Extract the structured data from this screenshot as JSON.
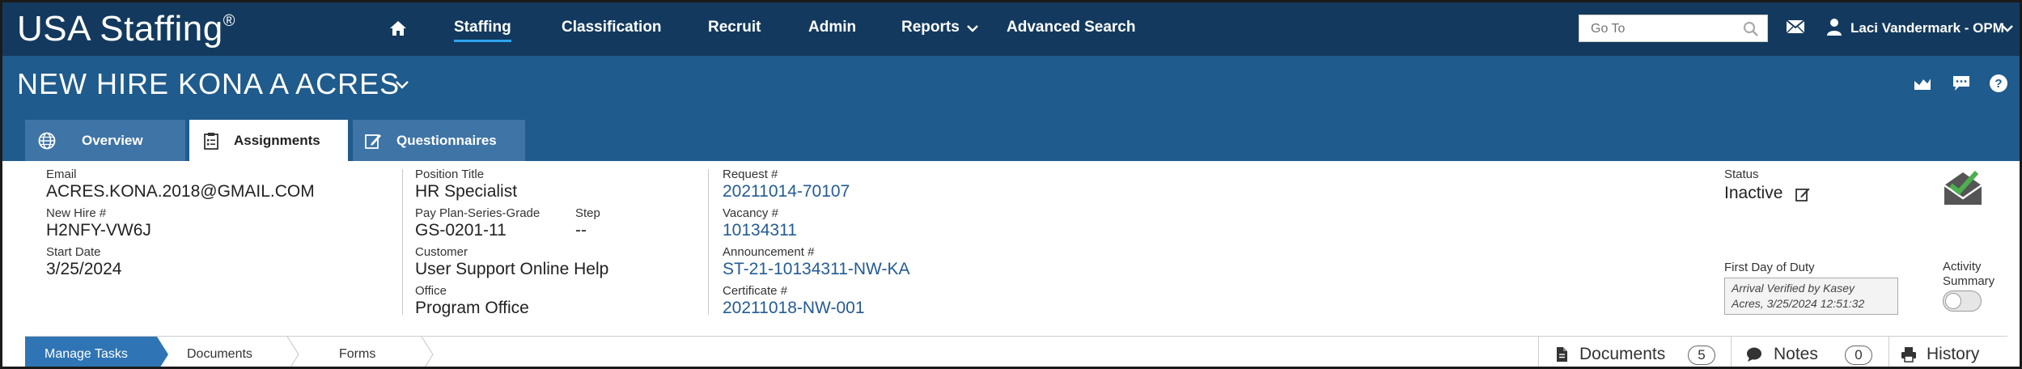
{
  "app": {
    "brand": "USA Staffing",
    "brand_mark": "®"
  },
  "nav": {
    "items": [
      {
        "label": "Staffing"
      },
      {
        "label": "Classification"
      },
      {
        "label": "Recruit"
      },
      {
        "label": "Admin"
      },
      {
        "label": "Reports"
      },
      {
        "label": "Advanced Search"
      }
    ],
    "goto_placeholder": "Go To",
    "user_name": "Laci Vandermark - OPM"
  },
  "header": {
    "title": "NEW HIRE KONA A ACRES"
  },
  "tabs": [
    {
      "label": "Overview"
    },
    {
      "label": "Assignments"
    },
    {
      "label": "Questionnaires"
    }
  ],
  "details": {
    "email_label": "Email",
    "email": "ACRES.KONA.2018@GMAIL.COM",
    "new_hire_label": "New Hire #",
    "new_hire": "H2NFY-VW6J",
    "start_date_label": "Start Date",
    "start_date": "3/25/2024",
    "position_title_label": "Position Title",
    "position_title": "HR Specialist",
    "pay_plan_label": "Pay Plan-Series-Grade",
    "pay_plan": "GS-0201-11",
    "step_label": "Step",
    "step": "--",
    "customer_label": "Customer",
    "customer": "User Support Online Help",
    "office_label": "Office",
    "office": "Program Office",
    "request_label": "Request #",
    "request": "20211014-70107",
    "vacancy_label": "Vacancy #",
    "vacancy": "10134311",
    "announcement_label": "Announcement #",
    "announcement": "ST-21-10134311-NW-KA",
    "certificate_label": "Certificate #",
    "certificate": "20211018-NW-001",
    "status_label": "Status",
    "status": "Inactive",
    "first_day_label": "First Day of Duty",
    "first_day_line1": "Arrival Verified by Kasey",
    "first_day_line2": "Acres, 3/25/2024 12:51:32",
    "activity_label_1": "Activity",
    "activity_label_2": "Summary"
  },
  "bottom_tabs": [
    {
      "label": "Manage Tasks"
    },
    {
      "label": "Documents"
    },
    {
      "label": "Forms"
    }
  ],
  "right_tabs": {
    "documents_label": "Documents",
    "documents_count": "5",
    "notes_label": "Notes",
    "notes_count": "0",
    "history_label": "History"
  },
  "colors": {
    "nav_bg": "#133a5e",
    "header_bg": "#1f5b8c",
    "tab_bg": "#3f74a6",
    "link": "#245b93",
    "accent": "#2ea3f2",
    "active_subtab": "#2f75b5"
  }
}
